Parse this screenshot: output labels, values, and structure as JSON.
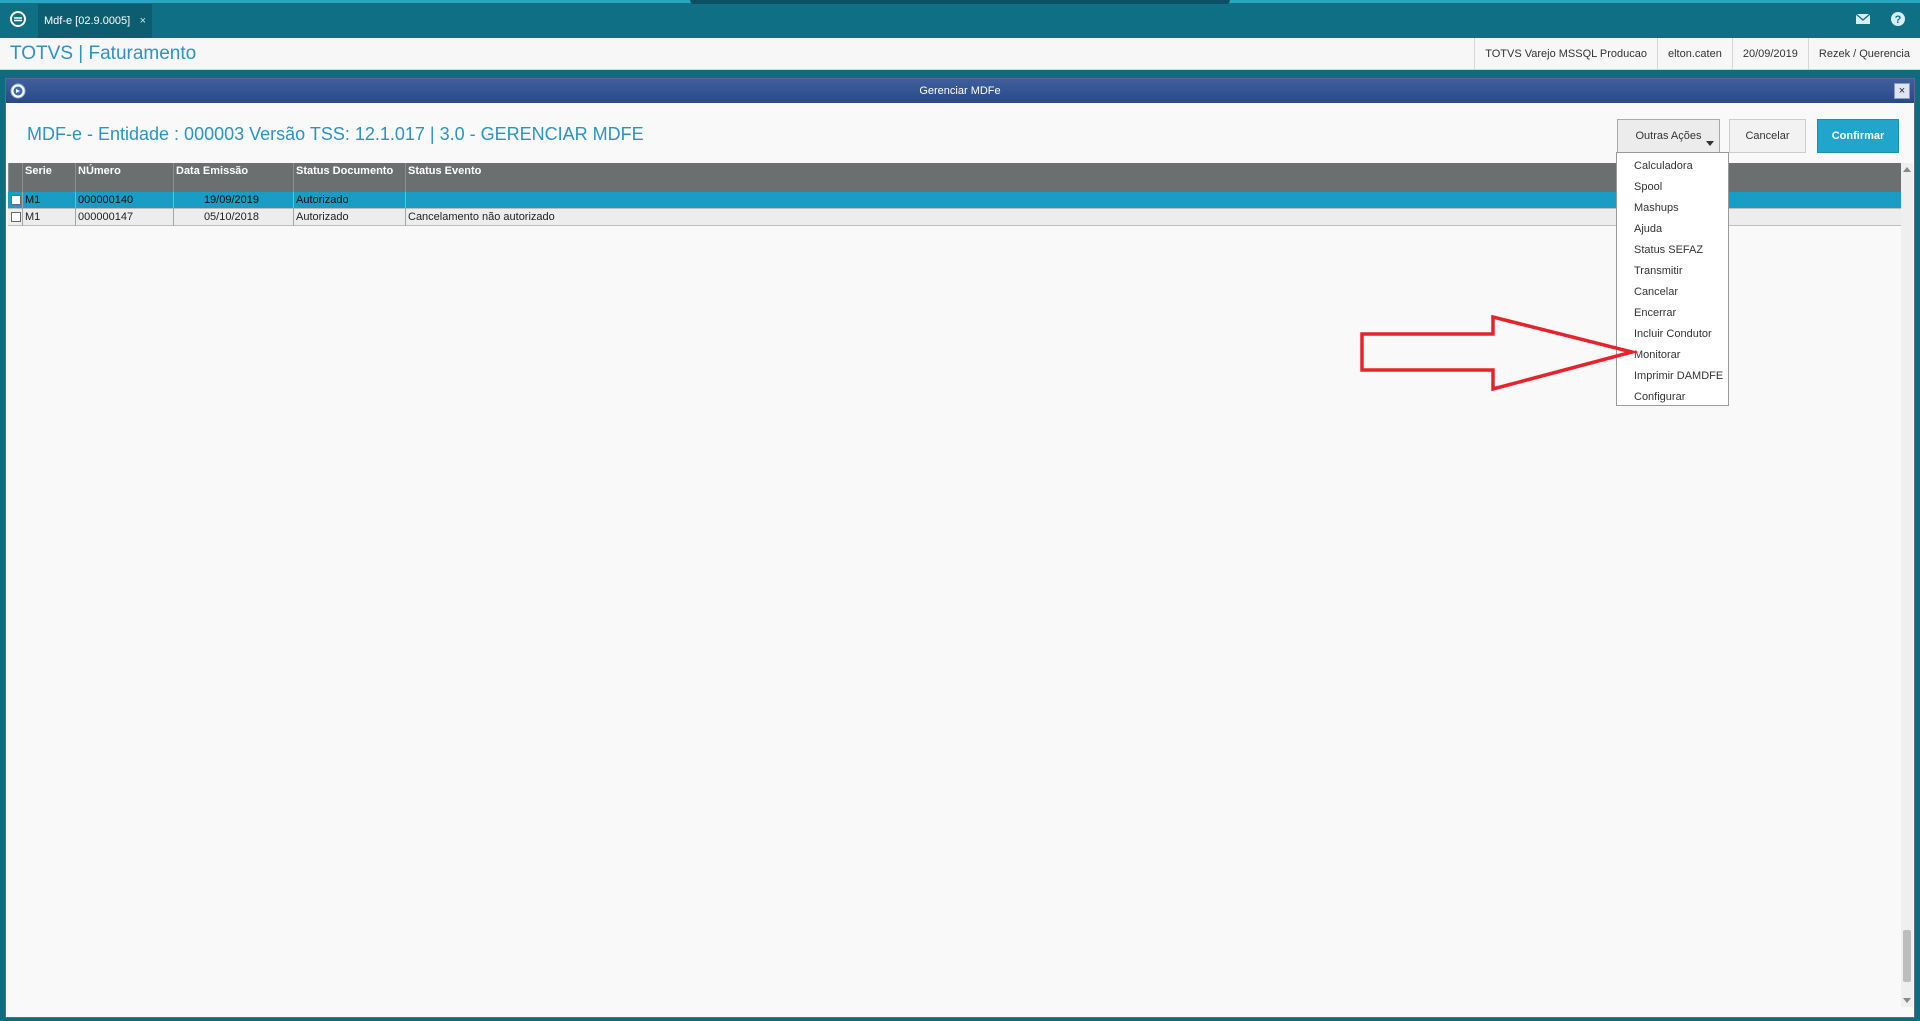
{
  "topbar": {
    "tab_label": "Mdf-e [02.9.0005]",
    "tab_close": "×"
  },
  "header": {
    "app_title": "TOTVS | Faturamento",
    "status": [
      "TOTVS Varejo MSSQL Producao",
      "elton.caten",
      "20/09/2019",
      "Rezek / Querencia"
    ]
  },
  "window": {
    "title": "Gerenciar MDFe",
    "close": "×",
    "heading": "MDF-e - Entidade : 000003 Versão TSS: 12.1.017 | 3.0 - GERENCIAR MDFE"
  },
  "buttons": {
    "outras_acoes": "Outras Ações",
    "cancelar": "Cancelar",
    "confirmar": "Confirmar"
  },
  "table": {
    "columns": [
      "Serie",
      "NÚmero",
      "Data Emissão",
      "Status Documento",
      "Status Evento"
    ],
    "rows": [
      {
        "serie": "M1",
        "numero": "000000140",
        "data": "19/09/2019",
        "status_doc": "Autorizado",
        "status_evento": "",
        "selected": true
      },
      {
        "serie": "M1",
        "numero": "000000147",
        "data": "05/10/2018",
        "status_doc": "Autorizado",
        "status_evento": "Cancelamento não autorizado",
        "selected": false
      }
    ]
  },
  "menu": {
    "items": [
      "Calculadora",
      "Spool",
      "Mashups",
      "Ajuda",
      "Status SEFAZ",
      "Transmitir",
      "Cancelar",
      "Encerrar",
      "Incluir Condutor",
      "Monitorar",
      "Imprimir DAMDFE",
      "Configurar"
    ]
  },
  "colors": {
    "topbar": "#0f6f84",
    "accent": "#2b94c2",
    "selected_row": "#1a9dc4",
    "confirm": "#22a5cb",
    "annotation_arrow": "#e8222a"
  },
  "icons": [
    "app-logo-icon",
    "mail-icon",
    "help-icon",
    "window-icon",
    "close-icon",
    "chevron-down-icon",
    "red-arrow-annotation"
  ]
}
